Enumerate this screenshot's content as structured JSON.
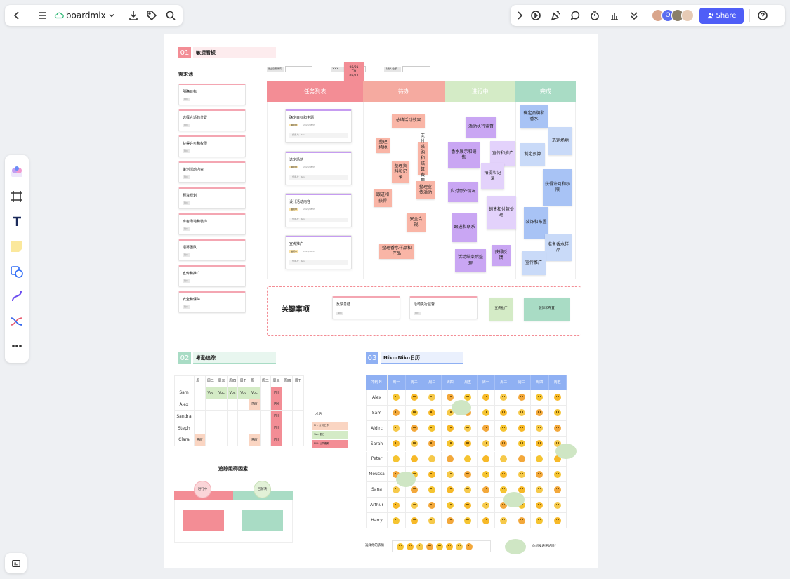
{
  "app": {
    "name": "boardmix",
    "share_label": "Share"
  },
  "colors": {
    "brand": "#4f5ef7",
    "red": "#f38d95",
    "pink": "#f5aaa0",
    "green": "#d4ebc6",
    "teal": "#a9dcc5",
    "purple": "#c9a6f3",
    "blue": "#a8c3f5"
  },
  "board": {
    "s1": {
      "num": "01",
      "title": "敏捷看板",
      "pool_title": "需求池",
      "pool": [
        "明确目标",
        "选择合适的位置",
        "获得许可和权限",
        "策划活动内容",
        "预算规划",
        "准备场地和装饰",
        "招募团队",
        "宣传和推广",
        "安全和保障"
      ],
      "pool_tag": "简介",
      "filters": [
        "截止日期/所有",
        "ＸＸＸ",
        "负责人/全部"
      ],
      "date_sticky": "08/01\nTO\n08/12",
      "columns": [
        "任务列表",
        "待办",
        "进行中",
        "完成"
      ],
      "tasks": [
        "确定目标和主题",
        "选定场地",
        "设计活动内容",
        "宣传推广"
      ],
      "task_status": "进行中",
      "task_date": "2023/08/05",
      "task_owner": "负责人：Ben",
      "todo": [
        "总结活动效果",
        "整理场地",
        "支付采购和结算费用",
        "整理资料和记录",
        "整理宣传活动",
        "跟进和获得",
        "安全合规",
        "整理香水样品和产品"
      ],
      "doing": [
        "活动执行监督",
        "香水展示和销售",
        "宣传和推广",
        "拍摄和记录",
        "应对意外情况",
        "销售和付款处理",
        "跟进和联系",
        "活动结束后整理",
        "获得反馈"
      ],
      "done": [
        "确定品牌和香水",
        "选定场地",
        "制定预算",
        "获得许可和权限",
        "装饰和布置",
        "准备香水样品",
        "宣传推广"
      ],
      "key_title": "关键事项",
      "key_cards": [
        "反馈总结",
        "活动执行监督"
      ],
      "key_stickies": [
        "宣传推广",
        "装饰和布置"
      ]
    },
    "s2": {
      "num": "02",
      "title": "考勤追踪",
      "days": [
        "周一",
        "周二",
        "周三",
        "周四",
        "周五",
        "周一",
        "周二",
        "周三",
        "周四",
        "周五"
      ],
      "people": [
        "Sam",
        "Alex",
        "Sandra",
        "Steph",
        "Clara"
      ],
      "legend_title": "术语",
      "legend": [
        "PH: 公司工作",
        "Voc: 假日",
        "RW: 公共假期"
      ],
      "obstacle_title": "追踪阻碍因素",
      "obstacle_cols": [
        "进行中",
        "已解决"
      ]
    },
    "s3": {
      "num": "03",
      "title": "Niko-Niko日历",
      "corner": "冲刺 N",
      "days": [
        "周一",
        "周二",
        "周三",
        "周四",
        "周五",
        "周一",
        "周二",
        "周三",
        "周四",
        "周五"
      ],
      "people": [
        "Alex",
        "Sam",
        "Aldirc",
        "Sarah",
        "Petar",
        "Moussa",
        "Sana",
        "Arthur",
        "Harry"
      ],
      "choose_label": "选择你的表情",
      "comment_label": "你想发表评论吗?"
    }
  }
}
